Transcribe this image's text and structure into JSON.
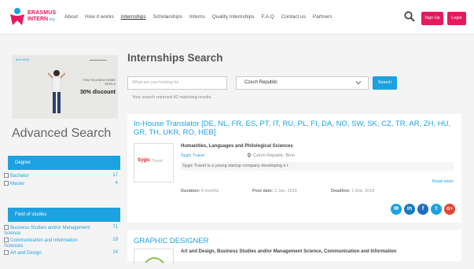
{
  "brand": {
    "line1": "ERASMUS",
    "line2": "INTERN",
    "suffix": ".org",
    "color": "#e5195e"
  },
  "nav": {
    "items": [
      {
        "label": "About"
      },
      {
        "label": "How it works"
      },
      {
        "label": "Internships",
        "active": true
      },
      {
        "label": "Scholarships"
      },
      {
        "label": "Interns"
      },
      {
        "label": "Quality Internships"
      },
      {
        "label": "F.A.Q"
      },
      {
        "label": "Contact us"
      },
      {
        "label": "Partners"
      }
    ],
    "search_icon": "search-icon",
    "signup_label": "Sign Up",
    "login_label": "Login"
  },
  "ad": {
    "tag": "[erro.store]",
    "text": "STAY IN A NEW HOME WITH A",
    "discount": "30% discount"
  },
  "sidebar": {
    "title": "Advanced Search",
    "degree": {
      "title": "Degree",
      "options": [
        {
          "label": "Bachelor",
          "count": "17"
        },
        {
          "label": "Master",
          "count": "4"
        }
      ]
    },
    "field": {
      "title": "Field of studies",
      "options": [
        {
          "label": "Business Studies and/or Management",
          "label2": "Science",
          "count": "71"
        },
        {
          "label": "Communication and Information",
          "label2": "Sciences",
          "count": "19"
        },
        {
          "label": "Art and Design",
          "count": "14"
        }
      ]
    }
  },
  "main": {
    "title": "Internships Search",
    "search_placeholder": "What are you looking for",
    "country": "Czech Republic",
    "search_button": "Search",
    "result_text": "Your search returned 42 matching results."
  },
  "listings": [
    {
      "title": "In-House Translator [DE, NL, FR, ES, PT, IT, RU, PL, FI, DA, NO, SW, SK, CZ, TR, AR, ZH, HU, GR, TH, UKR, RO, HEB]",
      "category": "Humanities, Languages and Philological Sciences",
      "company": "Sygic Travel",
      "logo_text1": "Sygic",
      "logo_text2": "Travel",
      "location": "Czech Republic, Brno",
      "description": "Sygic Travel is a young startup company developing a t",
      "read_more": "Read more",
      "duration_label": "Duration:",
      "duration": "6 months",
      "post_label": "Post date:",
      "post_date": "3 Jan, 2018",
      "deadline_label": "Deadline:",
      "deadline": "1 Mar, 2018",
      "share": [
        {
          "icon": "email-icon",
          "glyph": "✉",
          "color": "#1da1e0"
        },
        {
          "icon": "linkedin-icon",
          "glyph": "in",
          "color": "#1b7bb8"
        },
        {
          "icon": "facebook-icon",
          "glyph": "f",
          "color": "#1d6fc0"
        },
        {
          "icon": "twitter-icon",
          "glyph": "t",
          "color": "#1da1e0"
        },
        {
          "icon": "google-plus-icon",
          "glyph": "G+",
          "color": "#e2442f"
        }
      ]
    },
    {
      "title": "GRAPHIC DESIGNER",
      "category": "Art and Design, Business Studies and/or Management Science, Communication and Information"
    }
  ]
}
